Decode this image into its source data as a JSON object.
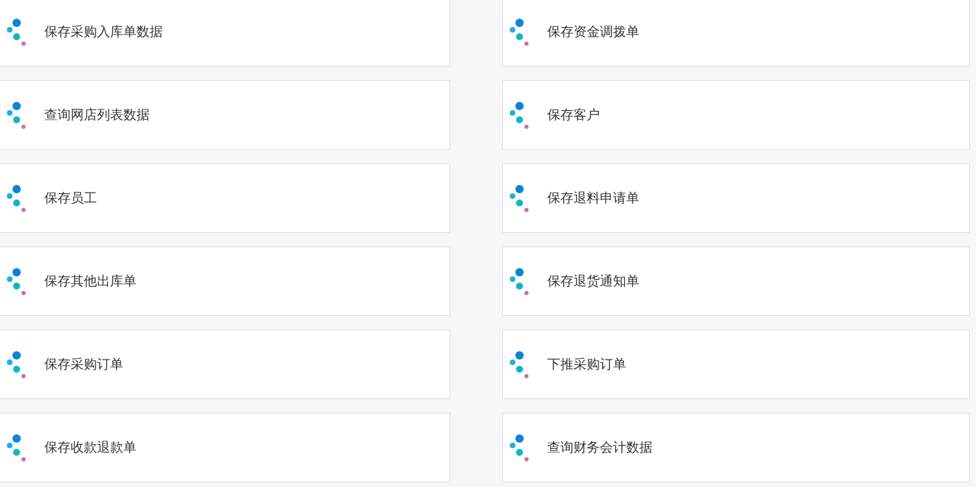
{
  "cards": [
    {
      "label": "保存采购入库单数据"
    },
    {
      "label": "保存资金调拨单"
    },
    {
      "label": "查询网店列表数据"
    },
    {
      "label": "保存客户"
    },
    {
      "label": "保存员工"
    },
    {
      "label": "保存退料申请单"
    },
    {
      "label": "保存其他出库单"
    },
    {
      "label": "保存退货通知单"
    },
    {
      "label": "保存采购订单"
    },
    {
      "label": "下推采购订单"
    },
    {
      "label": "保存收款退款单"
    },
    {
      "label": "查询财务会计数据"
    }
  ]
}
